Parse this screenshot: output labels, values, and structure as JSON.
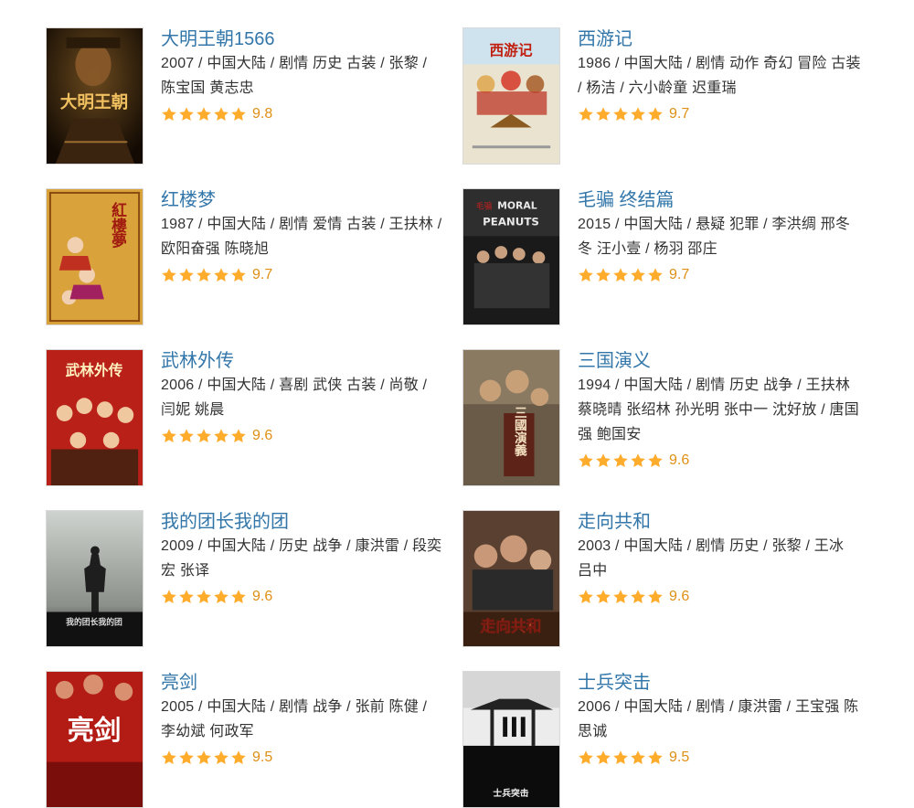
{
  "colors": {
    "title": "#3377aa",
    "meta": "#333333",
    "star": "#ffac2d",
    "score": "#e09015"
  },
  "star_icon": "star-icon",
  "movies": [
    {
      "title": "大明王朝1566",
      "meta": "2007 / 中国大陆 / 剧情 历史 古装 / 张黎 / 陈宝国 黄志忠",
      "rating": "9.8",
      "stars": 5,
      "poster_text": "大明王朝"
    },
    {
      "title": "西游记",
      "meta": "1986 / 中国大陆 / 剧情 动作 奇幻 冒险 古装 / 杨洁 / 六小龄童 迟重瑞",
      "rating": "9.7",
      "stars": 5,
      "poster_text": "西游记"
    },
    {
      "title": "红楼梦",
      "meta": "1987 / 中国大陆 / 剧情 爱情 古装 / 王扶林 / 欧阳奋强 陈晓旭",
      "rating": "9.7",
      "stars": 5,
      "poster_text": "紅樓夢"
    },
    {
      "title": "毛骗 终结篇",
      "meta": "2015 / 中国大陆 / 悬疑 犯罪 / 李洪绸 邢冬冬 汪小壹 / 杨羽 邵庄",
      "rating": "9.7",
      "stars": 5,
      "poster_text": "MORAL PEANUTS"
    },
    {
      "title": "武林外传",
      "meta": "2006 / 中国大陆 / 喜剧 武侠 古装 / 尚敬 / 闫妮 姚晨",
      "rating": "9.6",
      "stars": 5,
      "poster_text": "武林外传"
    },
    {
      "title": "三国演义",
      "meta": "1994 / 中国大陆 / 剧情 历史 战争 / 王扶林 蔡晓晴 张绍林 孙光明 张中一 沈好放 / 唐国强 鲍国安",
      "rating": "9.6",
      "stars": 5,
      "poster_text": "三國演義"
    },
    {
      "title": "我的团长我的团",
      "meta": "2009 / 中国大陆 / 历史 战争 / 康洪雷 / 段奕宏 张译",
      "rating": "9.6",
      "stars": 5,
      "poster_text": "我的团长我的团"
    },
    {
      "title": "走向共和",
      "meta": "2003 / 中国大陆 / 剧情 历史 / 张黎 / 王冰 吕中",
      "rating": "9.6",
      "stars": 5,
      "poster_text": "走向共和"
    },
    {
      "title": "亮剑",
      "meta": "2005 / 中国大陆 / 剧情 战争 / 张前 陈健 / 李幼斌 何政军",
      "rating": "9.5",
      "stars": 5,
      "poster_text": "亮剑"
    },
    {
      "title": "士兵突击",
      "meta": "2006 / 中国大陆 / 剧情 / 康洪雷 / 王宝强 陈思诚",
      "rating": "9.5",
      "stars": 5,
      "poster_text": "士兵突击"
    }
  ]
}
